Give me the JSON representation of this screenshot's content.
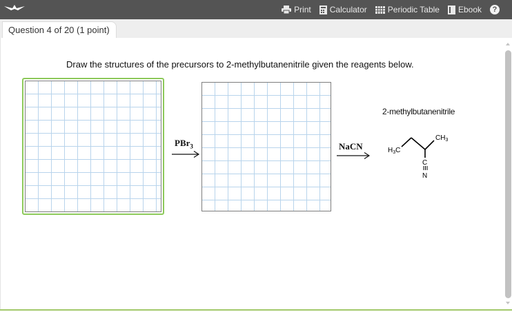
{
  "toolbar": {
    "print_label": "Print",
    "calculator_label": "Calculator",
    "periodic_table_label": "Periodic Table",
    "ebook_label": "Ebook",
    "help_label": "?"
  },
  "tab": {
    "label": "Question 4 of 20 (1 point)"
  },
  "question": {
    "prompt": "Draw the structures of the precursors to 2-methylbutanenitrile given the reagents below."
  },
  "reaction": {
    "reagent1": {
      "main": "PBr",
      "sub": "3"
    },
    "reagent2": "NaCN",
    "product_name": "2-methylbutanenitrile",
    "product_labels": {
      "h3c": "H",
      "h3c_sub": "3",
      "h3c_c": "C",
      "ch3": "CH",
      "ch3_sub": "3",
      "c": "C",
      "n": "N"
    }
  },
  "colors": {
    "topbar": "#545454",
    "selected_canvas_border": "#8dc95a",
    "grid_line": "#b8d4ec",
    "bottom_accent": "#a2c86a"
  }
}
